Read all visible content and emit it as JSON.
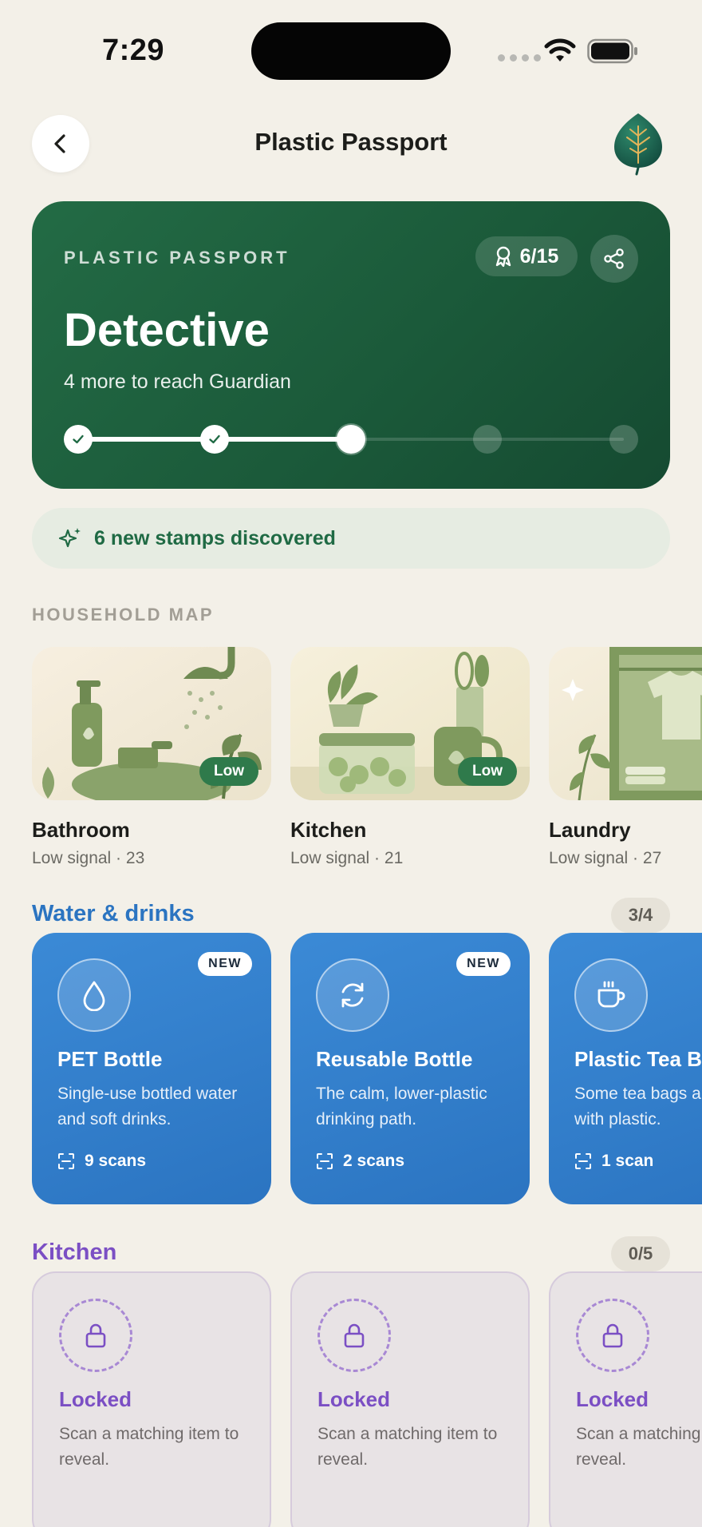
{
  "status_bar": {
    "time": "7:29"
  },
  "header": {
    "title": "Plastic Passport"
  },
  "hero": {
    "eyebrow": "PLASTIC PASSPORT",
    "count": "6/15",
    "title": "Detective",
    "subtitle": "4 more to reach Guardian",
    "progress_steps_total": 5,
    "progress_steps_done": 2,
    "progress_current_step": 3
  },
  "discover": {
    "label": "6 new stamps discovered"
  },
  "household": {
    "section_label": "HOUSEHOLD MAP",
    "rooms": [
      {
        "name": "Bathroom",
        "meta": "Low signal · 23",
        "badge": "Low"
      },
      {
        "name": "Kitchen",
        "meta": "Low signal · 21",
        "badge": "Low"
      },
      {
        "name": "Laundry",
        "meta": "Low signal · 27",
        "badge": ""
      }
    ]
  },
  "water": {
    "title": "Water & drinks",
    "count": "3/4",
    "title_color": "#2b74c1",
    "cards": [
      {
        "name": "PET Bottle",
        "badge": "NEW",
        "desc": "Single-use bottled water and soft drinks.",
        "scans": "9 scans",
        "icon": "droplet-icon"
      },
      {
        "name": "Reusable Bottle",
        "badge": "NEW",
        "desc": "The calm, lower-plastic drinking path.",
        "scans": "2 scans",
        "icon": "refresh-icon"
      },
      {
        "name": "Plastic Tea Bags",
        "badge": "",
        "desc": "Some tea bags are sealed with plastic.",
        "scans": "1 scan",
        "icon": "cup-icon"
      }
    ]
  },
  "kitchen": {
    "title": "Kitchen",
    "count": "0/5",
    "title_color": "#7b4fc4",
    "cards": [
      {
        "title": "Locked",
        "desc": "Scan a matching item to reveal."
      },
      {
        "title": "Locked",
        "desc": "Scan a matching item to reveal."
      },
      {
        "title": "Locked",
        "desc": "Scan a matching item to reveal."
      }
    ]
  }
}
